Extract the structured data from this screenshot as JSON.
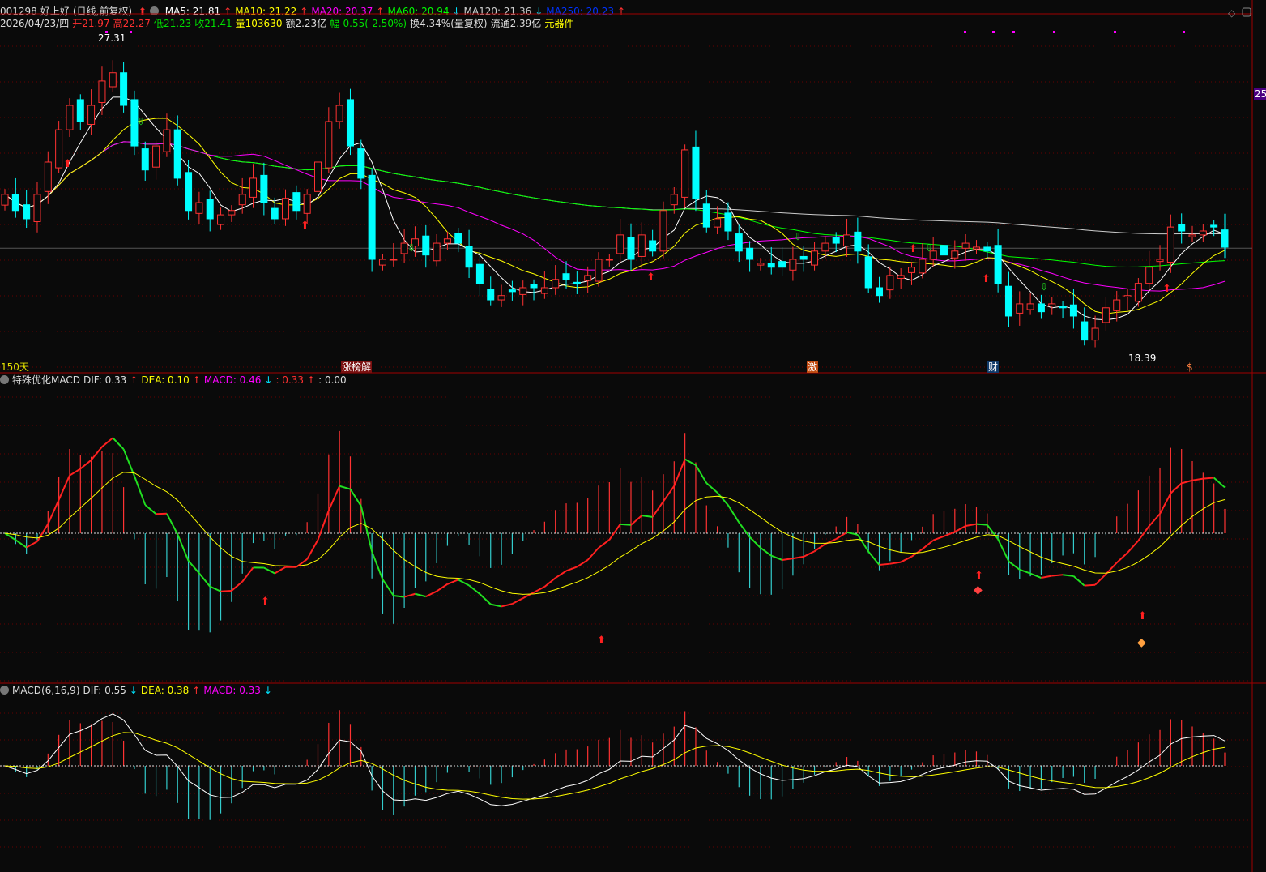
{
  "header": {
    "code": "001298",
    "name": "好上好",
    "mode": "(日线,前复权)",
    "ma": [
      {
        "label": "MA5: 21.81",
        "dir": "up",
        "color": "#ffffff"
      },
      {
        "label": "MA10: 21.22",
        "dir": "up",
        "color": "#ffff00"
      },
      {
        "label": "MA20: 20.37",
        "dir": "up",
        "color": "#ff00ff"
      },
      {
        "label": "MA60: 20.94",
        "dir": "down",
        "color": "#00ff00"
      },
      {
        "label": "MA120: 21.36",
        "dir": "down",
        "color": "#cccccc"
      },
      {
        "label": "MA250: 20.23",
        "dir": "up",
        "color": "#0033ff"
      }
    ],
    "date": "2026/04/23/四",
    "open": "开21.97",
    "high": "高22.27",
    "low": "低21.23",
    "close": "收21.41",
    "vol": "量103630",
    "amount": "额2.23亿",
    "change": "幅-0.55(-2.50%)",
    "turnover": "换4.34%(量复权)",
    "float": "流通2.39亿",
    "sector": "元器件"
  },
  "main": {
    "high_label": "27.31",
    "low_label": "18.39",
    "days_label": "150天",
    "axis_label": "25",
    "tags": [
      "涨榜解",
      "激",
      "财",
      "$"
    ]
  },
  "macd1": {
    "title": "特殊优化MACD",
    "dif": "DIF: 0.33",
    "dea": "DEA: 0.10",
    "macd": "MACD: 0.46",
    "v4": ": 0.33",
    "v5": ": 0.00"
  },
  "macd2": {
    "title": "MACD(6,16,9)",
    "dif": "DIF: 0.55",
    "dea": "DEA: 0.38",
    "macd": "MACD: 0.33"
  },
  "chart_data": {
    "type": "candlestick",
    "series_colors": {
      "up": "#ff3232",
      "down": "#00ffff",
      "ma5": "#ffffff",
      "ma10": "#ffff00",
      "ma20": "#ff00ff",
      "ma60": "#00ff00",
      "ma120": "#cccccc",
      "ma250": "#0033ff"
    },
    "close": [
      22.91,
      22.46,
      22.23,
      22.91,
      23.81,
      24.71,
      25.39,
      24.94,
      25.39,
      26.07,
      26.3,
      25.39,
      24.26,
      23.59,
      24.26,
      24.71,
      23.36,
      22.46,
      22.68,
      22.23,
      22.34,
      22.46,
      22.91,
      23.36,
      22.68,
      22.23,
      22.8,
      22.46,
      22.91,
      23.81,
      24.94,
      25.39,
      24.26,
      23.36,
      21.1,
      21.1,
      21.1,
      21.55,
      21.67,
      21.22,
      21.55,
      21.67,
      21.55,
      20.88,
      20.43,
      19.97,
      20.09,
      20.2,
      20.31,
      20.31,
      20.31,
      20.54,
      20.54,
      20.43,
      20.65,
      21.1,
      21.1,
      21.78,
      21.1,
      21.78,
      21.33,
      22.46,
      22.91,
      24.15,
      22.8,
      22.0,
      22.23,
      21.89,
      21.33,
      21.1,
      20.99,
      20.88,
      20.88,
      21.1,
      21.1,
      21.33,
      21.55,
      21.55,
      21.78,
      21.33,
      20.31,
      20.09,
      20.65,
      20.65,
      20.88,
      21.1,
      21.33,
      21.22,
      21.33,
      21.55,
      21.44,
      21.33,
      20.43,
      19.52,
      19.86,
      19.86,
      19.64,
      19.86,
      19.75,
      19.52,
      18.85,
      19.18,
      19.75,
      19.97,
      20.09,
      20.43,
      20.88,
      21.1,
      22.0,
      21.89,
      21.78,
      21.89,
      22.0,
      21.44
    ],
    "ylim": [
      18.39,
      27.31
    ]
  }
}
